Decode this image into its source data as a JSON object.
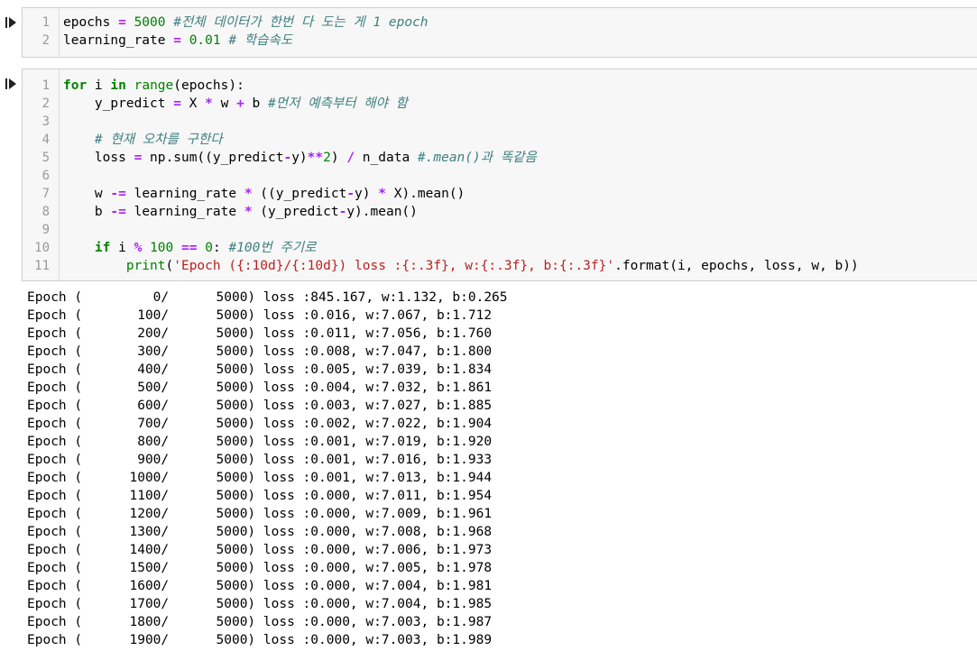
{
  "cell1": {
    "lines": [
      {
        "n": "1",
        "parts": [
          {
            "t": "epochs ",
            "c": "code"
          },
          {
            "t": "=",
            "c": "op"
          },
          {
            "t": " ",
            "c": "code"
          },
          {
            "t": "5000",
            "c": "num"
          },
          {
            "t": " #전체 데이터가 한번 다 도는 게 1 epoch",
            "c": "cmt"
          }
        ]
      },
      {
        "n": "2",
        "parts": [
          {
            "t": "learning_rate ",
            "c": "code"
          },
          {
            "t": "=",
            "c": "op"
          },
          {
            "t": " ",
            "c": "code"
          },
          {
            "t": "0.01",
            "c": "num"
          },
          {
            "t": " # 학습속도",
            "c": "cmt"
          }
        ]
      }
    ]
  },
  "cell2": {
    "lines": [
      {
        "n": "1",
        "parts": [
          {
            "t": "for",
            "c": "kw"
          },
          {
            "t": " i ",
            "c": "code"
          },
          {
            "t": "in",
            "c": "kw"
          },
          {
            "t": " ",
            "c": "code"
          },
          {
            "t": "range",
            "c": "bi"
          },
          {
            "t": "(epochs):",
            "c": "code"
          }
        ]
      },
      {
        "n": "2",
        "parts": [
          {
            "t": "    y_predict ",
            "c": "code"
          },
          {
            "t": "=",
            "c": "op"
          },
          {
            "t": " X ",
            "c": "code"
          },
          {
            "t": "*",
            "c": "op"
          },
          {
            "t": " w ",
            "c": "code"
          },
          {
            "t": "+",
            "c": "op"
          },
          {
            "t": " b ",
            "c": "code"
          },
          {
            "t": "#먼저 예측부터 해야 함",
            "c": "cmt"
          }
        ]
      },
      {
        "n": "3",
        "parts": []
      },
      {
        "n": "4",
        "parts": [
          {
            "t": "    ",
            "c": "code"
          },
          {
            "t": "# 현재 오차를 구한다",
            "c": "cmt"
          }
        ]
      },
      {
        "n": "5",
        "parts": [
          {
            "t": "    loss ",
            "c": "code"
          },
          {
            "t": "=",
            "c": "op"
          },
          {
            "t": " np.sum((y_predict",
            "c": "code"
          },
          {
            "t": "-",
            "c": "op"
          },
          {
            "t": "y)",
            "c": "code"
          },
          {
            "t": "**",
            "c": "op"
          },
          {
            "t": "2",
            "c": "num"
          },
          {
            "t": ") ",
            "c": "code"
          },
          {
            "t": "/",
            "c": "op"
          },
          {
            "t": " n_data ",
            "c": "code"
          },
          {
            "t": "#.mean()과 똑같음",
            "c": "cmt"
          }
        ]
      },
      {
        "n": "6",
        "parts": []
      },
      {
        "n": "7",
        "parts": [
          {
            "t": "    w ",
            "c": "code"
          },
          {
            "t": "-=",
            "c": "op"
          },
          {
            "t": " learning_rate ",
            "c": "code"
          },
          {
            "t": "*",
            "c": "op"
          },
          {
            "t": " ((y_predict",
            "c": "code"
          },
          {
            "t": "-",
            "c": "op"
          },
          {
            "t": "y) ",
            "c": "code"
          },
          {
            "t": "*",
            "c": "op"
          },
          {
            "t": " X).mean()",
            "c": "code"
          }
        ]
      },
      {
        "n": "8",
        "parts": [
          {
            "t": "    b ",
            "c": "code"
          },
          {
            "t": "-=",
            "c": "op"
          },
          {
            "t": " learning_rate ",
            "c": "code"
          },
          {
            "t": "*",
            "c": "op"
          },
          {
            "t": " (y_predict",
            "c": "code"
          },
          {
            "t": "-",
            "c": "op"
          },
          {
            "t": "y).mean()",
            "c": "code"
          }
        ]
      },
      {
        "n": "9",
        "parts": []
      },
      {
        "n": "10",
        "parts": [
          {
            "t": "    ",
            "c": "code"
          },
          {
            "t": "if",
            "c": "kw"
          },
          {
            "t": " i ",
            "c": "code"
          },
          {
            "t": "%",
            "c": "op"
          },
          {
            "t": " ",
            "c": "code"
          },
          {
            "t": "100",
            "c": "num"
          },
          {
            "t": " ",
            "c": "code"
          },
          {
            "t": "==",
            "c": "op"
          },
          {
            "t": " ",
            "c": "code"
          },
          {
            "t": "0",
            "c": "num"
          },
          {
            "t": ": ",
            "c": "code"
          },
          {
            "t": "#100번 주기로",
            "c": "cmt"
          }
        ]
      },
      {
        "n": "11",
        "parts": [
          {
            "t": "        ",
            "c": "code"
          },
          {
            "t": "print",
            "c": "bi"
          },
          {
            "t": "(",
            "c": "code"
          },
          {
            "t": "'Epoch ({:10d}/{:10d}) loss :{:.3f}, w:{:.3f}, b:{:.3f}'",
            "c": "str"
          },
          {
            "t": ".format(i, epochs, loss, w, b))",
            "c": "code"
          }
        ]
      }
    ]
  },
  "output": {
    "lines": [
      "Epoch (         0/      5000) loss :845.167, w:1.132, b:0.265",
      "Epoch (       100/      5000) loss :0.016, w:7.067, b:1.712",
      "Epoch (       200/      5000) loss :0.011, w:7.056, b:1.760",
      "Epoch (       300/      5000) loss :0.008, w:7.047, b:1.800",
      "Epoch (       400/      5000) loss :0.005, w:7.039, b:1.834",
      "Epoch (       500/      5000) loss :0.004, w:7.032, b:1.861",
      "Epoch (       600/      5000) loss :0.003, w:7.027, b:1.885",
      "Epoch (       700/      5000) loss :0.002, w:7.022, b:1.904",
      "Epoch (       800/      5000) loss :0.001, w:7.019, b:1.920",
      "Epoch (       900/      5000) loss :0.001, w:7.016, b:1.933",
      "Epoch (      1000/      5000) loss :0.001, w:7.013, b:1.944",
      "Epoch (      1100/      5000) loss :0.000, w:7.011, b:1.954",
      "Epoch (      1200/      5000) loss :0.000, w:7.009, b:1.961",
      "Epoch (      1300/      5000) loss :0.000, w:7.008, b:1.968",
      "Epoch (      1400/      5000) loss :0.000, w:7.006, b:1.973",
      "Epoch (      1500/      5000) loss :0.000, w:7.005, b:1.978",
      "Epoch (      1600/      5000) loss :0.000, w:7.004, b:1.981",
      "Epoch (      1700/      5000) loss :0.000, w:7.004, b:1.985",
      "Epoch (      1800/      5000) loss :0.000, w:7.003, b:1.987",
      "Epoch (      1900/      5000) loss :0.000, w:7.003, b:1.989"
    ]
  }
}
